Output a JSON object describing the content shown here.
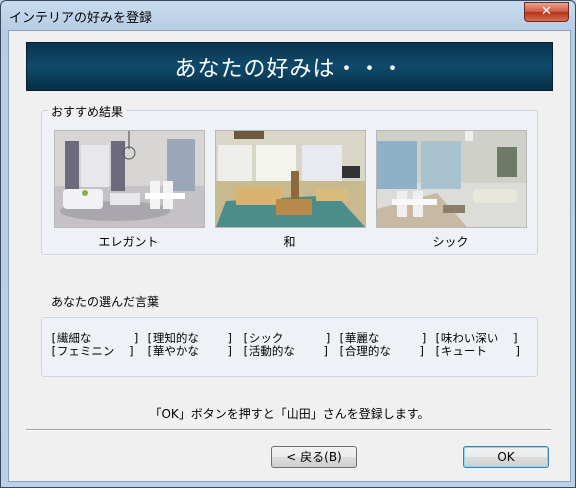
{
  "window": {
    "title": "インテリアの好みを登録",
    "close_label": "✕"
  },
  "banner": {
    "text": "あなたの好みは・・・"
  },
  "recommend": {
    "group_label": "おすすめ結果",
    "items": [
      {
        "label": "エレガント"
      },
      {
        "label": "和"
      },
      {
        "label": "シック"
      }
    ]
  },
  "words": {
    "label": "あなたの選んだ言葉",
    "row1": [
      "[繊細な      ]",
      "[理知的な    ]",
      "[シック      ]",
      "[華麗な      ]",
      "[味わい深い  ]"
    ],
    "row2": [
      "[フェミニン  ]",
      "[華やかな    ]",
      "[活動的な    ]",
      "[合理的な    ]",
      "[キュート    ]"
    ]
  },
  "message": "「OK」ボタンを押すと「山田」さんを登録します。",
  "buttons": {
    "back": "< 戻る(B)",
    "ok": "OK"
  }
}
